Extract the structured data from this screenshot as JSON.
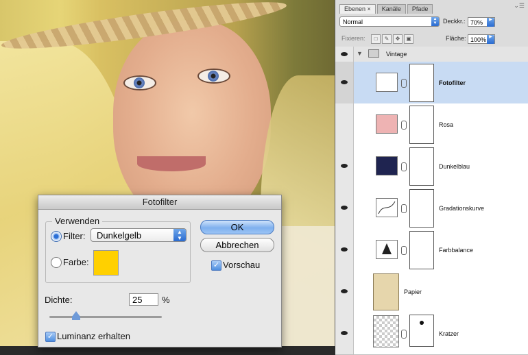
{
  "dialog": {
    "title": "Fotofilter",
    "group_label": "Verwenden",
    "filter_label": "Filter:",
    "filter_value": "Dunkelgelb",
    "color_label": "Farbe:",
    "color_hex": "#ffd000",
    "ok_label": "OK",
    "cancel_label": "Abbrechen",
    "preview_label": "Vorschau",
    "density_label": "Dichte:",
    "density_value": "25",
    "density_unit": "%",
    "density_level": 25,
    "preserve_label": "Luminanz erhalten"
  },
  "panel": {
    "tabs": [
      "Ebenen",
      "Kanäle",
      "Pfade"
    ],
    "blend_mode": "Normal",
    "opacity_label": "Deckkr.:",
    "opacity_value": "70%",
    "lock_label": "Fixieren:",
    "fill_label": "Fläche:",
    "fill_value": "100%",
    "group_name": "Vintage",
    "layers": [
      {
        "name": "Fotofilter",
        "selected": true
      },
      {
        "name": "Rosa",
        "selected": false
      },
      {
        "name": "Dunkelblau",
        "selected": false
      },
      {
        "name": "Gradationskurve",
        "selected": false
      },
      {
        "name": "Farbbalance",
        "selected": false
      },
      {
        "name": "Papier",
        "selected": false
      },
      {
        "name": "Kratzer",
        "selected": false
      }
    ],
    "colors": {
      "rosa": "#eeb3b3",
      "dunkelblau": "#1f2450",
      "papier": "#e6d6ac"
    }
  }
}
